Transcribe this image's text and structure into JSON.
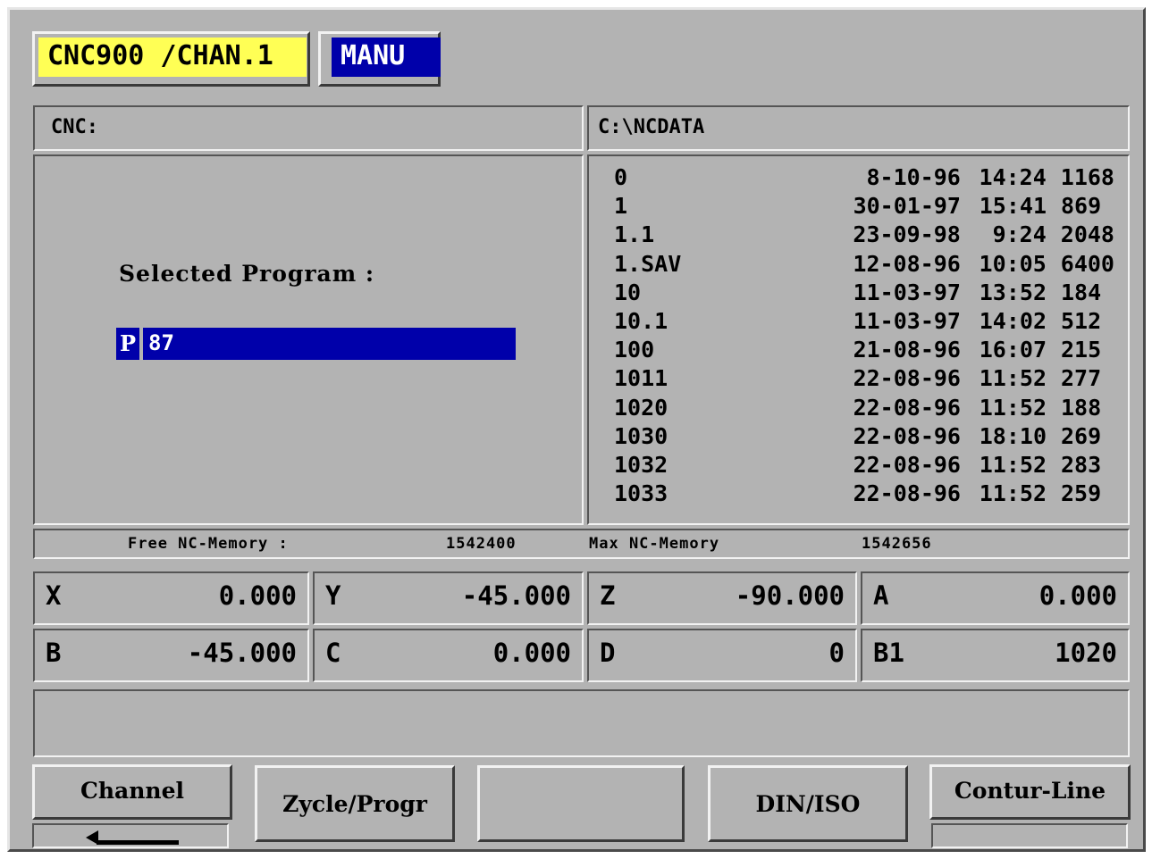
{
  "header": {
    "channel_label": "CNC900 /CHAN.1",
    "mode_label": "MANU"
  },
  "left_panel": {
    "title": "CNC:",
    "selected_program_label": "Selected Program :",
    "program_prefix": "P",
    "program_value": "87"
  },
  "right_panel": {
    "path": "C:\\NCDATA",
    "files": [
      {
        "name": "0",
        "date": "8-10-96",
        "time": "14:24",
        "size": "1168"
      },
      {
        "name": "1",
        "date": "30-01-97",
        "time": "15:41",
        "size": "869"
      },
      {
        "name": "1.1",
        "date": "23-09-98",
        "time": "9:24",
        "size": "2048"
      },
      {
        "name": "1.SAV",
        "date": "12-08-96",
        "time": "10:05",
        "size": "6400"
      },
      {
        "name": "10",
        "date": "11-03-97",
        "time": "13:52",
        "size": "184"
      },
      {
        "name": "10.1",
        "date": "11-03-97",
        "time": "14:02",
        "size": "512"
      },
      {
        "name": "100",
        "date": "21-08-96",
        "time": "16:07",
        "size": "215"
      },
      {
        "name": "1011",
        "date": "22-08-96",
        "time": "11:52",
        "size": "277"
      },
      {
        "name": "1020",
        "date": "22-08-96",
        "time": "11:52",
        "size": "188"
      },
      {
        "name": "1030",
        "date": "22-08-96",
        "time": "18:10",
        "size": "269"
      },
      {
        "name": "1032",
        "date": "22-08-96",
        "time": "11:52",
        "size": "283"
      },
      {
        "name": "1033",
        "date": "22-08-96",
        "time": "11:52",
        "size": "259"
      }
    ]
  },
  "memory": {
    "free_label": "Free  NC-Memory :",
    "free_value": "1542400",
    "max_label": "Max   NC-Memory",
    "max_value": "1542656"
  },
  "axes": [
    {
      "name": "X",
      "value": "0.000"
    },
    {
      "name": "Y",
      "value": "-45.000"
    },
    {
      "name": "Z",
      "value": "-90.000"
    },
    {
      "name": "A",
      "value": "0.000"
    },
    {
      "name": "B",
      "value": "-45.000"
    },
    {
      "name": "C",
      "value": "0.000"
    },
    {
      "name": "D",
      "value": "0"
    },
    {
      "name": "B1",
      "value": "1020"
    }
  ],
  "message_line": "",
  "softkeys": {
    "k1": "Channel",
    "k2": "Zycle/Progr",
    "k3": "",
    "k4": "DIN/ISO",
    "k5": "Contur-Line"
  },
  "icons": {
    "return": "return-arrow-icon"
  }
}
